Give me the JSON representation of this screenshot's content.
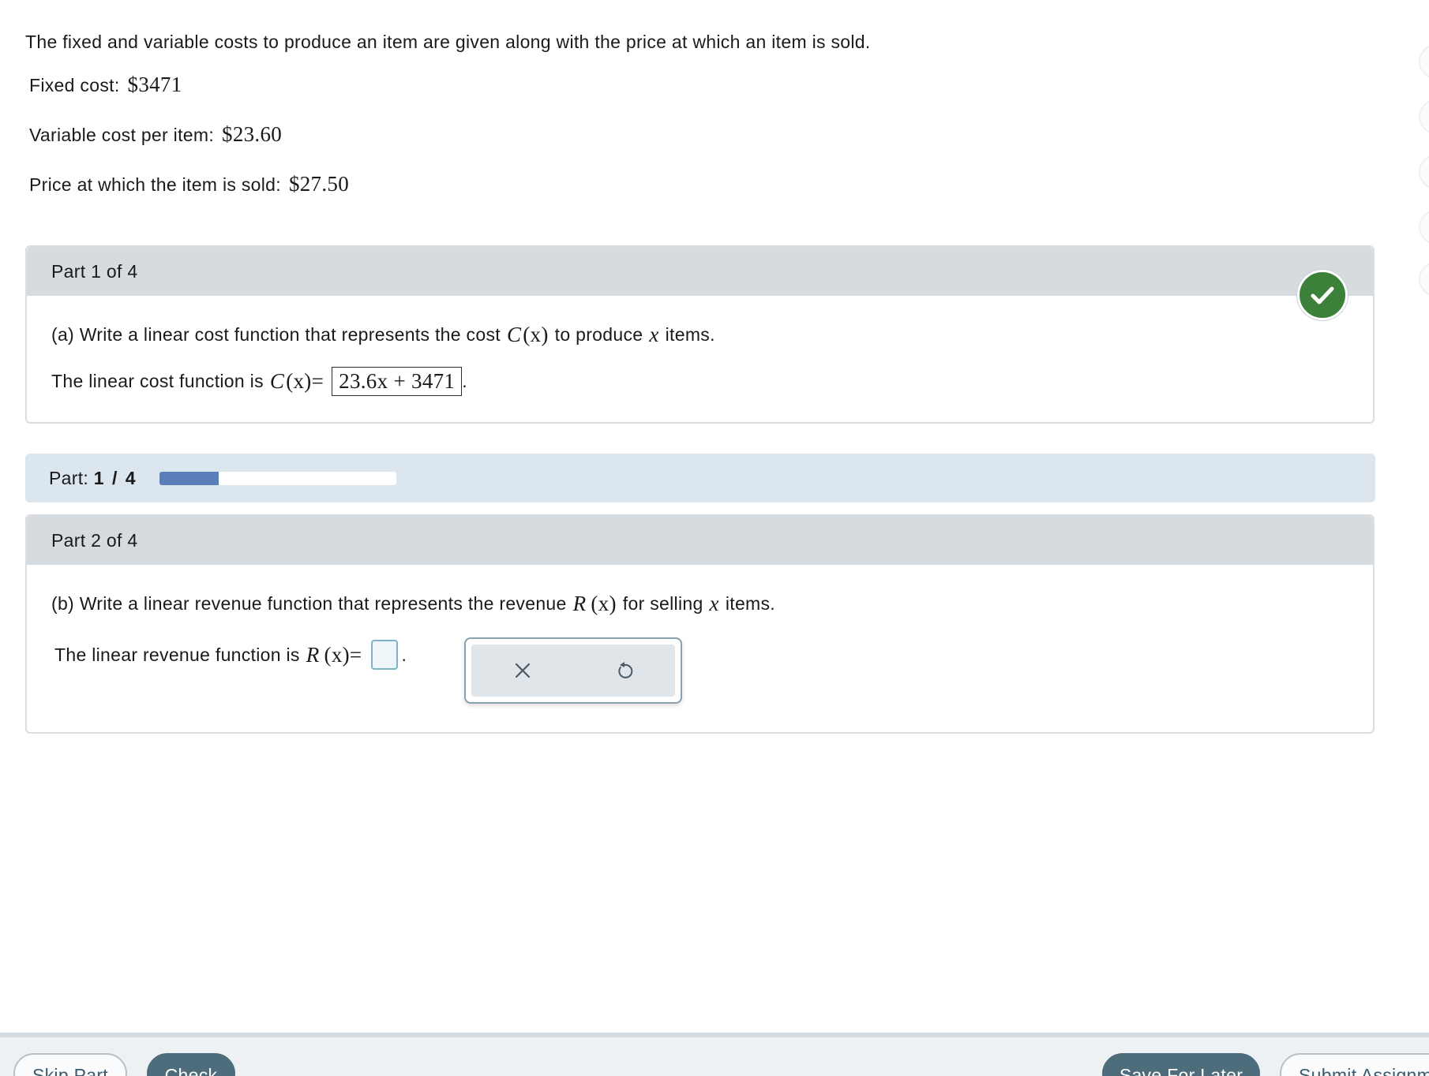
{
  "problem": {
    "intro": "The fixed and variable costs to produce an item are given along with the price at which an item is sold.",
    "fixed_cost_label": "Fixed cost:",
    "fixed_cost_value": "$3471",
    "variable_cost_label": "Variable cost per item:",
    "variable_cost_value": "$23.60",
    "price_label": "Price at which the item is sold:",
    "price_value": "$27.50"
  },
  "part1": {
    "header": "Part 1 of 4",
    "question_prefix": "(a) Write a linear cost function that represents the cost",
    "question_func": "C",
    "question_arg": "(x)",
    "question_mid": "to produce",
    "question_var": "x",
    "question_suffix": "items.",
    "answer_prefix": "The linear cost function is",
    "answer_func": "C",
    "answer_arg": "(x)=",
    "answer_value": "23.6x + 3471",
    "answer_end": ".",
    "status": "correct"
  },
  "progress": {
    "label": "Part:",
    "value": "1 / 4",
    "fraction": 0.25
  },
  "part2": {
    "header": "Part 2 of 4",
    "question_prefix": "(b) Write a linear revenue function that represents the revenue",
    "question_func": "R",
    "question_arg": "(x)",
    "question_mid": "for selling",
    "question_var": "x",
    "question_suffix": "items.",
    "answer_prefix": "The linear revenue function is",
    "answer_func": "R",
    "answer_arg": "(x)=",
    "answer_end": "."
  },
  "tools": {
    "clear_icon": "close-icon",
    "undo_icon": "undo-icon"
  },
  "footer": {
    "skip_label": "Skip Part",
    "check_label": "Check",
    "save_label": "Save For Later",
    "submit_label": "Submit Assignm"
  },
  "colors": {
    "correct_green": "#3b8139",
    "progress_fill": "#5a7fb8",
    "header_gray": "#d5dbdf",
    "button_dark": "#4d6c7c"
  }
}
